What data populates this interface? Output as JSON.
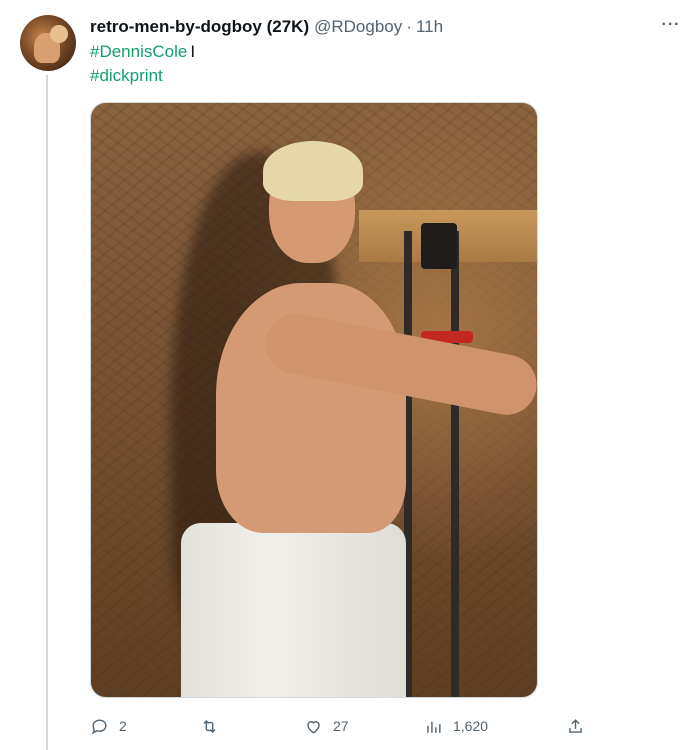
{
  "tweet": {
    "display_name": "retro-men-by-dogboy (27K)",
    "handle": "@RDogboy",
    "separator": "·",
    "time": "11h",
    "more_label": "···",
    "body": {
      "hashtag1": "#DennisCole",
      "suffix": "I",
      "hashtag2": "#dickprint"
    },
    "actions": {
      "reply_count": "2",
      "retweet_count": "",
      "like_count": "27",
      "views_count": "1,620"
    }
  },
  "colors": {
    "hashtag": "#11a06b",
    "muted": "#536471",
    "thread_line": "#cfd9de"
  },
  "icons": [
    "avatar",
    "more-icon",
    "reply-icon",
    "retweet-icon",
    "like-icon",
    "views-icon",
    "share-icon"
  ]
}
